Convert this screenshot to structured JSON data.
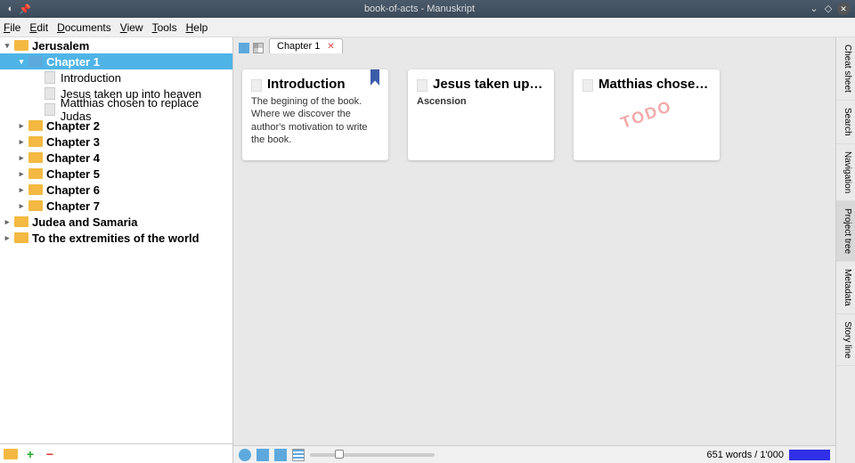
{
  "window": {
    "title": "book-of-acts - Manuskript"
  },
  "menu": {
    "file": "File",
    "edit": "Edit",
    "documents": "Documents",
    "view": "View",
    "tools": "Tools",
    "help": "Help"
  },
  "tree": {
    "jerusalem": "Jerusalem",
    "chapter1": "Chapter 1",
    "intro": "Introduction",
    "jesus": "Jesus taken up into heaven",
    "matthias": "Matthias chosen to replace Judas",
    "chapter2": "Chapter 2",
    "chapter3": "Chapter 3",
    "chapter4": "Chapter 4",
    "chapter5": "Chapter 5",
    "chapter6": "Chapter 6",
    "chapter7": "Chapter 7",
    "judea": "Judea and Samaria",
    "extremities": "To the extremities of the world"
  },
  "tab": {
    "label": "Chapter 1"
  },
  "cards": {
    "c1": {
      "title": "Introduction",
      "body": "The begining of the book. Where we discover the author's motivation to write the book."
    },
    "c2": {
      "title": "Jesus taken up int…",
      "body": "Ascension"
    },
    "c3": {
      "title": "Matthias chosen t…",
      "stamp": "TODO"
    }
  },
  "right": {
    "cheat": "Cheat sheet",
    "search": "Search",
    "nav": "Navigation",
    "project": "Project tree",
    "meta": "Metadata",
    "story": "Story line"
  },
  "status": {
    "words": "651 words / 1'000"
  }
}
